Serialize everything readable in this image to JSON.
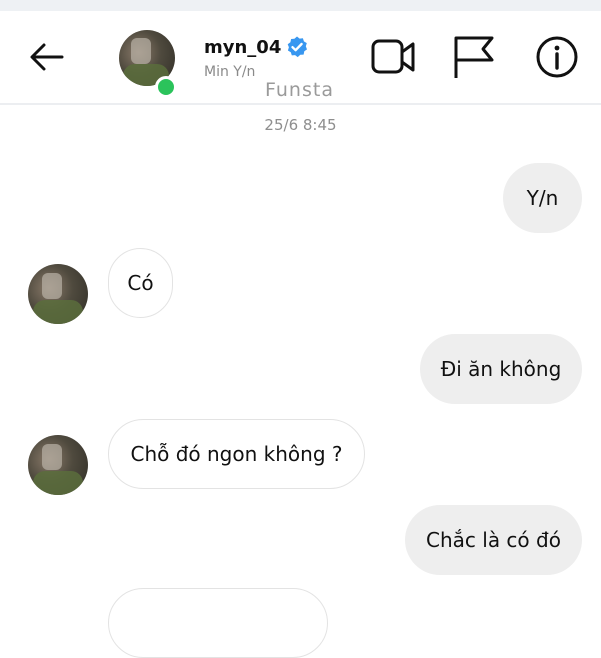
{
  "header": {
    "username": "myn_04",
    "subtitle": "Min Y/n",
    "watermark": "Funsta",
    "verified": true,
    "online": true,
    "icons": [
      "back-arrow-icon",
      "video-call-icon",
      "flag-icon",
      "info-icon"
    ]
  },
  "timestamp": "25/6 8:45",
  "messages": [
    {
      "from": "me",
      "text": "Y/n"
    },
    {
      "from": "them",
      "text": "Có"
    },
    {
      "from": "me",
      "text": "Đi ăn không"
    },
    {
      "from": "them",
      "text": "Chỗ đó ngon không ?"
    },
    {
      "from": "me",
      "text": "Chắc là có đó"
    }
  ],
  "colors": {
    "verified_badge": "#3897f0",
    "online_dot": "#2bc35b",
    "outgoing_bubble": "#eeeeee",
    "incoming_bubble": "#ffffff"
  }
}
